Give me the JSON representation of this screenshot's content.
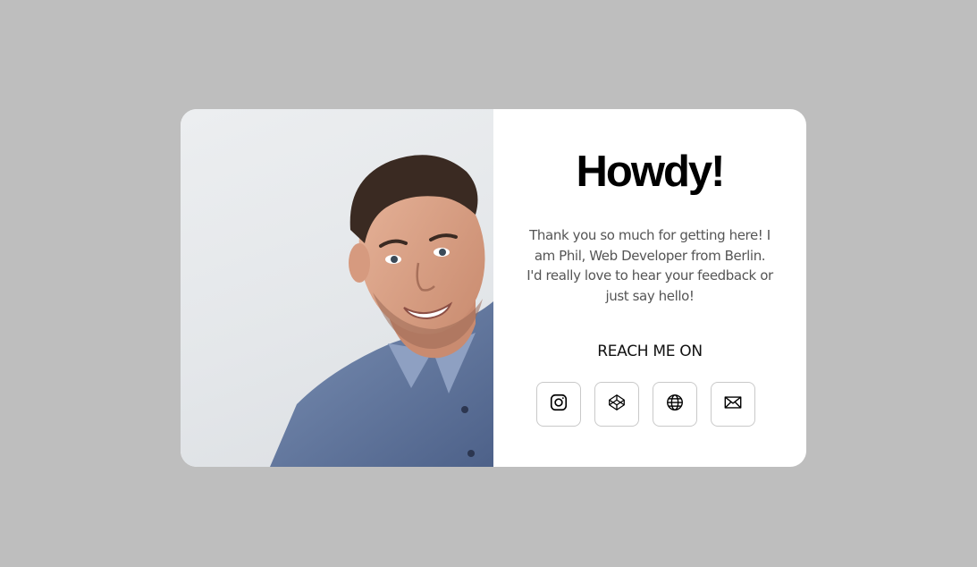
{
  "card": {
    "title": "Howdy!",
    "message": "Thank you so much for getting here! I am Phil, Web Developer from Berlin. I'd really love to hear your feedback or just say hello!",
    "reach_label": "REACH ME ON",
    "photo_alt": "Portrait of Phil",
    "socials": [
      {
        "name": "Instagram",
        "icon": "instagram-icon"
      },
      {
        "name": "CodePen",
        "icon": "codepen-icon"
      },
      {
        "name": "Website",
        "icon": "globe-icon"
      },
      {
        "name": "Email",
        "icon": "mail-icon"
      }
    ]
  },
  "colors": {
    "page_background": "#bebebe",
    "card_background": "#ffffff",
    "title": "#000000",
    "message": "#555555",
    "button_border": "#c9c9c9"
  }
}
